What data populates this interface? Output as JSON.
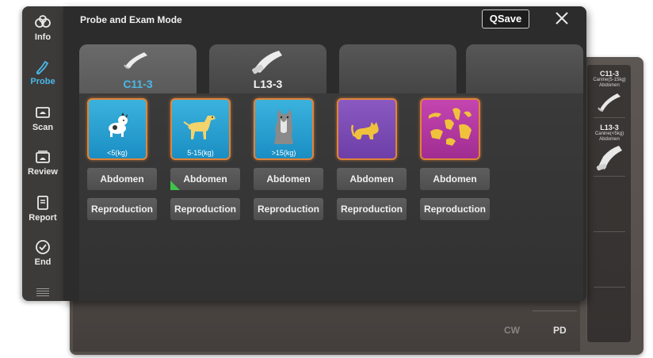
{
  "sidebar": {
    "items": [
      {
        "label": "Info",
        "icon": "info-icon"
      },
      {
        "label": "Probe",
        "icon": "probe-icon",
        "active": true
      },
      {
        "label": "Scan",
        "icon": "scan-icon"
      },
      {
        "label": "Review",
        "icon": "review-icon"
      },
      {
        "label": "Report",
        "icon": "report-icon"
      },
      {
        "label": "End",
        "icon": "end-icon"
      }
    ],
    "menu_icon": "menu-icon"
  },
  "dialog": {
    "title": "Probe and Exam Mode",
    "qsave_label": "QSave",
    "close_icon": "close-icon"
  },
  "tabs": [
    {
      "label": "C11-3",
      "active": true
    },
    {
      "label": "L13-3",
      "active": false
    },
    {
      "label": "",
      "active": false
    },
    {
      "label": "",
      "active": false
    }
  ],
  "animals": [
    {
      "label": "<5(kg)",
      "icon": "small-dog-icon",
      "color": "#2ba0d4"
    },
    {
      "label": "5-15(kg)",
      "icon": "medium-dog-icon",
      "color": "#2ba0d4"
    },
    {
      "label": ">15(kg)",
      "icon": "large-dog-icon",
      "color": "#2ba0d4"
    },
    {
      "label": "",
      "icon": "cat-icon",
      "color": "#7b4cb6"
    },
    {
      "label": "",
      "icon": "exotic-animals-icon",
      "color": "#b4389f"
    }
  ],
  "exam_rows": {
    "abdomen": [
      "Abdomen",
      "Abdomen",
      "Abdomen",
      "Abdomen",
      "Abdomen"
    ],
    "reproduction": [
      "Reproduction",
      "Reproduction",
      "Reproduction",
      "Reproduction",
      "Reproduction"
    ]
  },
  "right_panel": {
    "probes": [
      {
        "name": "C11-3",
        "sub1": "Canine(5-15kg)",
        "sub2": "Abdomen"
      },
      {
        "name": "L13-3",
        "sub1": "Canine(<5kg)",
        "sub2": "Abdomen"
      }
    ]
  },
  "background": {
    "cw_label": "CW",
    "pd_label": "PD"
  },
  "colors": {
    "accent": "#4ab8e6",
    "highlight_border": "#e0843a",
    "selected_marker": "#3fc44a"
  }
}
